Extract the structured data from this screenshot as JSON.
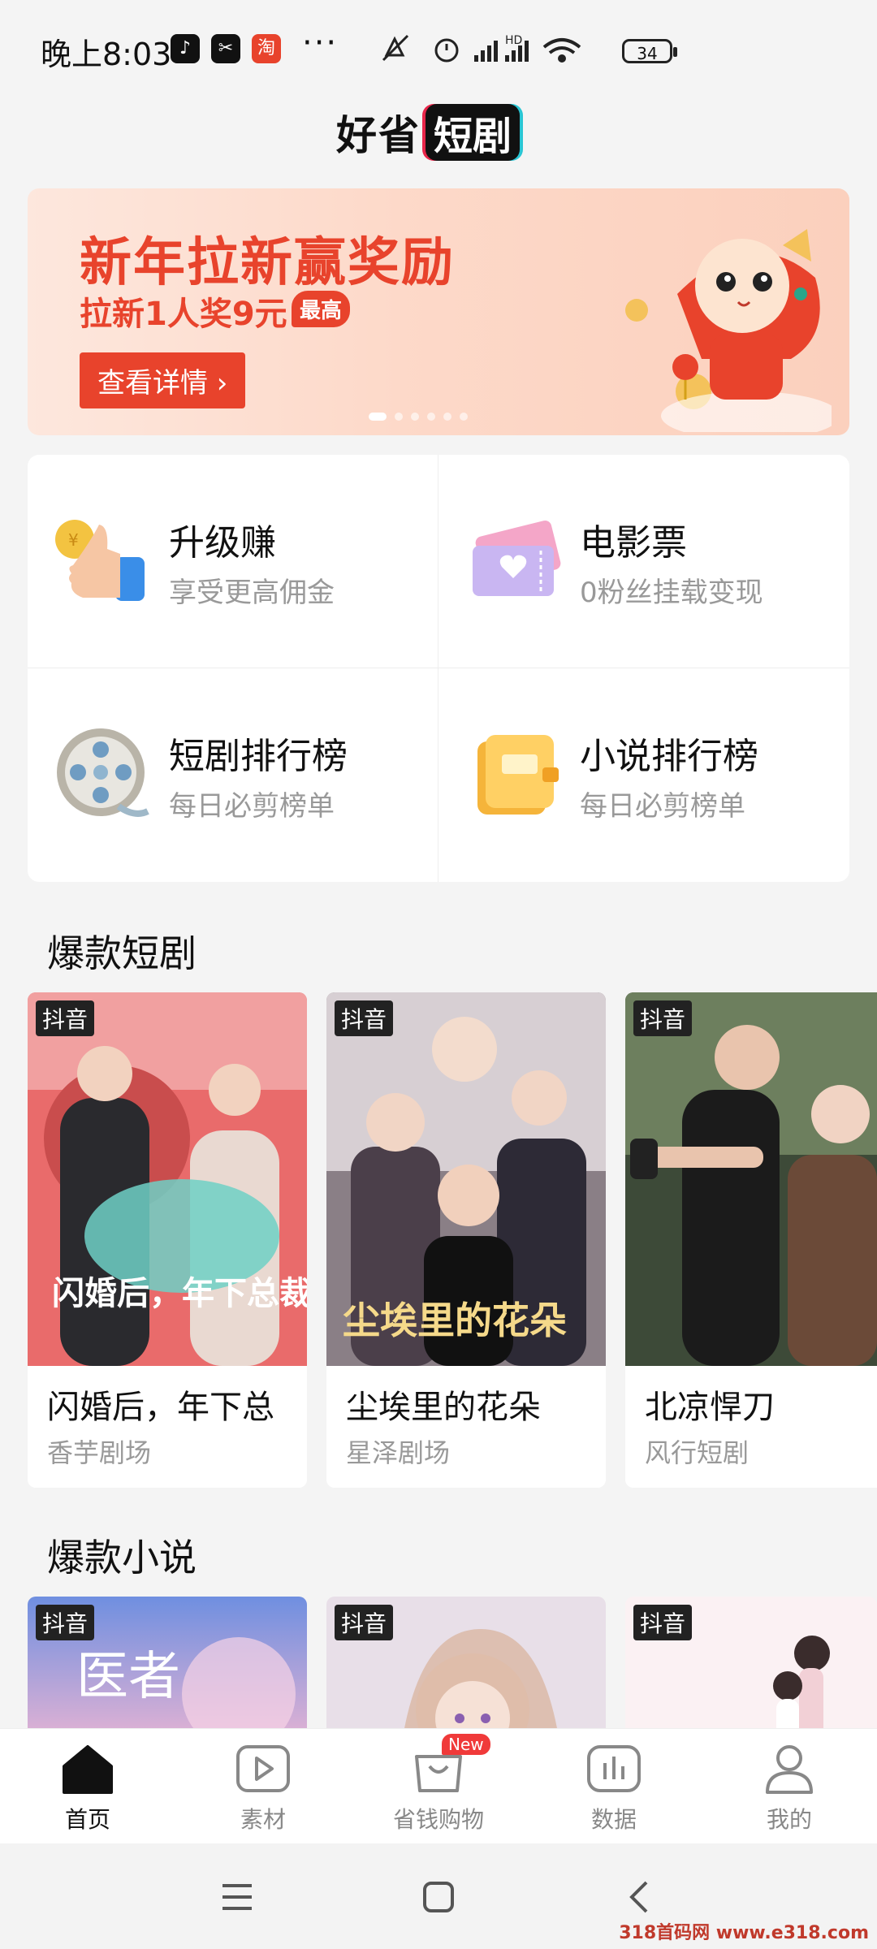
{
  "status": {
    "time": "晚上8:03",
    "battery": "34",
    "network": "HD"
  },
  "header": {
    "logo_part1": "好省",
    "logo_part2": "短剧"
  },
  "banner": {
    "title": "新年拉新赢奖励",
    "subtitle": "拉新1人奖9元",
    "tag": "最高",
    "button": "查看详情 ›"
  },
  "features": [
    {
      "title": "升级赚",
      "subtitle": "享受更高佣金",
      "icon": "thumbs-up-coin-icon"
    },
    {
      "title": "电影票",
      "subtitle": "0粉丝挂载变现",
      "icon": "ticket-icon"
    },
    {
      "title": "短剧排行榜",
      "subtitle": "每日必剪榜单",
      "icon": "film-reel-icon"
    },
    {
      "title": "小说排行榜",
      "subtitle": "每日必剪榜单",
      "icon": "book-icon"
    }
  ],
  "sections": {
    "dramas_title": "爆款短剧",
    "novels_title": "爆款小说"
  },
  "dramas": [
    {
      "badge": "抖音",
      "title": "闪婚后，年下总",
      "studio": "香芋剧场",
      "poster_text": "闪婚后，年下总裁狠狠爱"
    },
    {
      "badge": "抖音",
      "title": "尘埃里的花朵",
      "studio": "星泽剧场",
      "poster_text": "尘埃里的花朵"
    },
    {
      "badge": "抖音",
      "title": "北凉悍刀",
      "studio": "风行短剧",
      "poster_text": ""
    }
  ],
  "novels": [
    {
      "badge": "抖音",
      "poster_text": "医者"
    },
    {
      "badge": "抖音",
      "poster_text": ""
    },
    {
      "badge": "抖音",
      "poster_text": ""
    }
  ],
  "tabbar": {
    "home": "首页",
    "material": "素材",
    "shopping": "省钱购物",
    "shopping_badge": "New",
    "data": "数据",
    "mine": "我的"
  },
  "watermark": "318首码网 www.e318.com"
}
